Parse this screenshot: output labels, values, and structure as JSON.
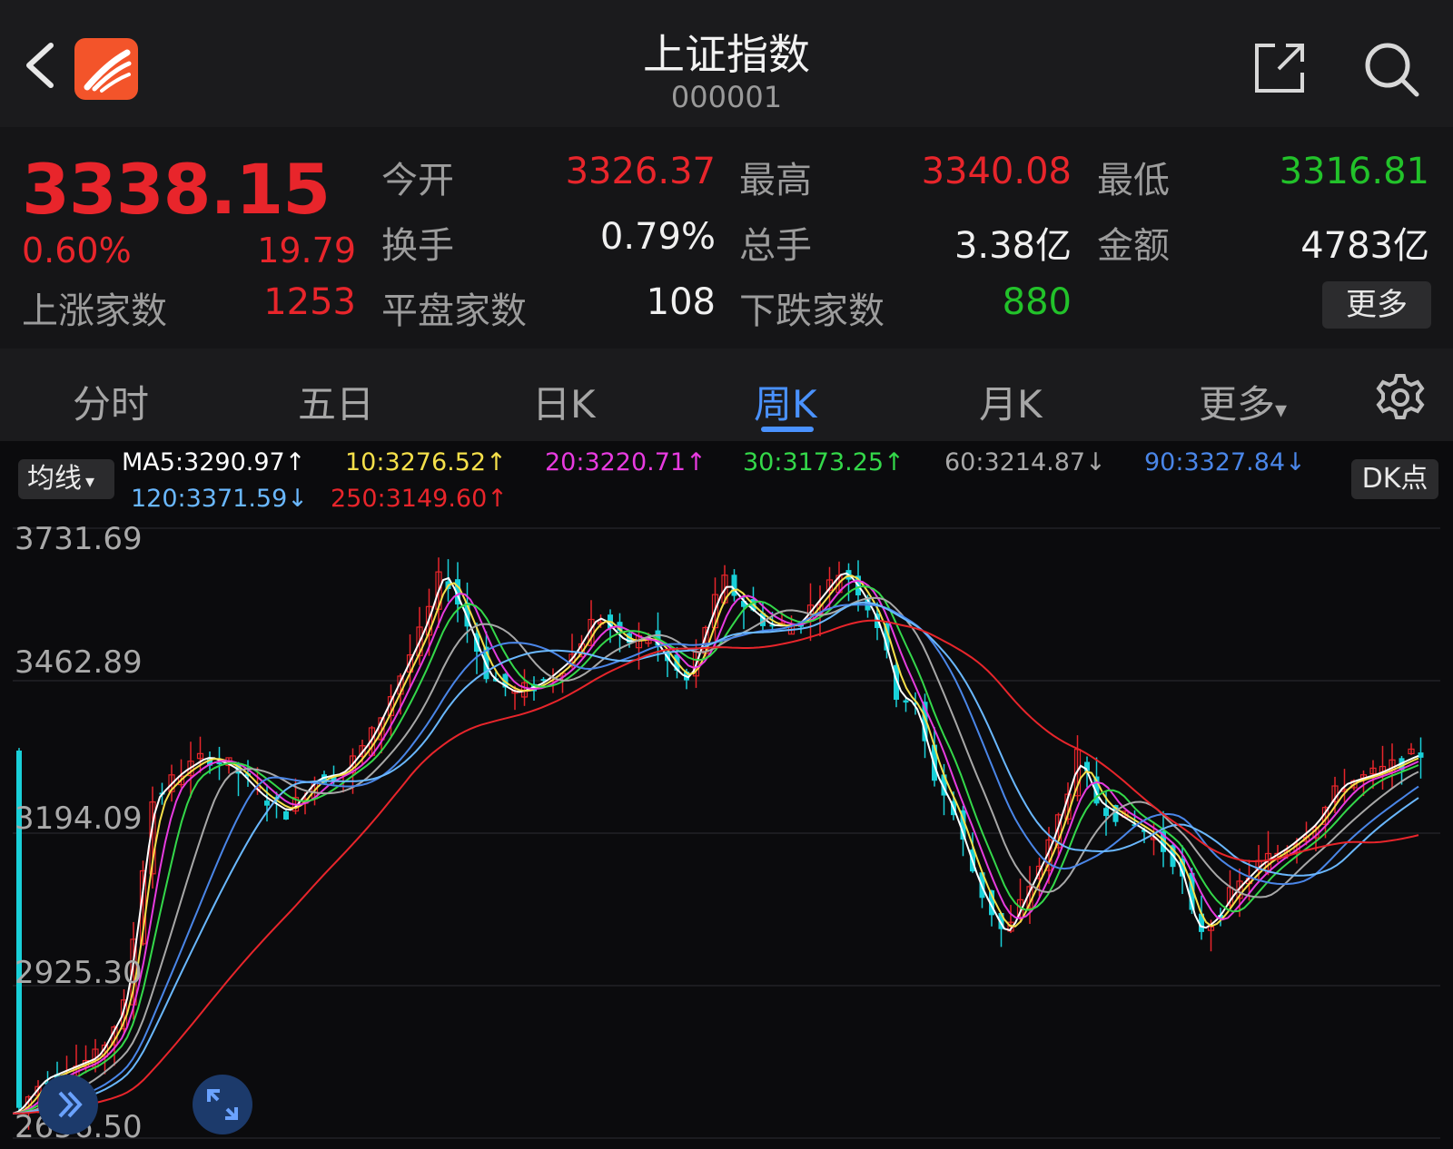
{
  "header": {
    "title": "上证指数",
    "code": "000001"
  },
  "quote": {
    "price": "3338.15",
    "change_pct": "0.60%",
    "change_abs": "19.79",
    "stats": [
      {
        "label": "今开",
        "value": "3326.37",
        "color": "#e8252b"
      },
      {
        "label": "最高",
        "value": "3340.08",
        "color": "#e8252b"
      },
      {
        "label": "最低",
        "value": "3316.81",
        "color": "#22c22a"
      },
      {
        "label": "换手",
        "value": "0.79%",
        "color": "#f0f0f0"
      },
      {
        "label": "总手",
        "value": "3.38亿",
        "color": "#f0f0f0"
      },
      {
        "label": "金额",
        "value": "4783亿",
        "color": "#f0f0f0"
      },
      {
        "label": "上涨家数",
        "value": "1253",
        "color": "#e8252b"
      },
      {
        "label": "平盘家数",
        "value": "108",
        "color": "#f0f0f0"
      },
      {
        "label": "下跌家数",
        "value": "880",
        "color": "#22c22a"
      }
    ],
    "more_label": "更多"
  },
  "tabs": {
    "items": [
      "分时",
      "五日",
      "日K",
      "周K",
      "月K",
      "更多"
    ],
    "active": "周K",
    "more_caret": "▾"
  },
  "ma_bar": {
    "select_label": "均线",
    "select_caret": "▾",
    "items": [
      {
        "text": "MA5:3290.97↑",
        "color": "#ffffff"
      },
      {
        "text": "10:3276.52↑",
        "color": "#f5e04a"
      },
      {
        "text": "20:3220.71↑",
        "color": "#e83be0"
      },
      {
        "text": "30:3173.25↑",
        "color": "#34d84a"
      },
      {
        "text": "60:3214.87↓",
        "color": "#a8a8a8"
      },
      {
        "text": "90:3327.84↓",
        "color": "#4a86e8"
      },
      {
        "text": "120:3371.59↓",
        "color": "#6ab8ff"
      },
      {
        "text": "250:3149.60↑",
        "color": "#e8252b"
      }
    ],
    "dk_label": "DK点"
  },
  "chart_data": {
    "type": "candlestick",
    "y_ticks": [
      "3731.69",
      "3462.89",
      "3194.09",
      "2925.30",
      "2656.50"
    ],
    "ylim": [
      2656.5,
      3731.69
    ],
    "grid": true,
    "ma_colors": [
      "#ffffff",
      "#f5e04a",
      "#e83be0",
      "#34d84a",
      "#a8a8a8",
      "#4a86e8",
      "#6ab8ff",
      "#e8252b"
    ],
    "up_color": "#e8252b",
    "down_color": "#19d0d8"
  },
  "chart_buttons": {
    "expand_icon": "double-chevron-right-icon",
    "fullscreen_icon": "expand-arrows-icon"
  }
}
